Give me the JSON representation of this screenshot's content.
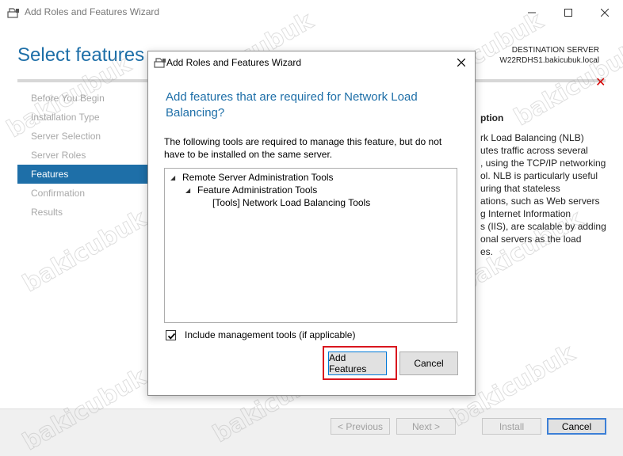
{
  "window": {
    "title": "Add Roles and Features Wizard",
    "page_title": "Select features",
    "destination_label": "DESTINATION SERVER",
    "destination_server": "W22RDHS1.bakicubuk.local"
  },
  "nav": {
    "items": [
      {
        "label": "Before You Begin",
        "active": false
      },
      {
        "label": "Installation Type",
        "active": false
      },
      {
        "label": "Server Selection",
        "active": false
      },
      {
        "label": "Server Roles",
        "active": false
      },
      {
        "label": "Features",
        "active": true
      },
      {
        "label": "Confirmation",
        "active": false
      },
      {
        "label": "Results",
        "active": false
      }
    ]
  },
  "description": {
    "title": "ption",
    "lines": [
      "rk Load Balancing (NLB)",
      "utes traffic across several",
      ", using the TCP/IP networking",
      "ol. NLB is particularly useful",
      "uring that stateless",
      "ations, such as Web servers",
      "g Internet Information",
      "s (IIS), are scalable by adding",
      "onal servers as the load",
      "es."
    ]
  },
  "buttons": {
    "previous": "< Previous",
    "next": "Next >",
    "install": "Install",
    "cancel": "Cancel"
  },
  "dialog": {
    "title": "Add Roles and Features Wizard",
    "heading": "Add features that are required for Network Load Balancing?",
    "text": "The following tools are required to manage this feature, but do not have to be installed on the same server.",
    "tree": [
      {
        "label": "Remote Server Administration Tools",
        "level": 0,
        "expanded": true
      },
      {
        "label": "Feature Administration Tools",
        "level": 1,
        "expanded": true
      },
      {
        "label": "[Tools] Network Load Balancing Tools",
        "level": 2,
        "expanded": false
      }
    ],
    "include_tools_label": "Include management tools (if applicable)",
    "include_tools_checked": true,
    "add_features_label": "Add Features",
    "cancel_label": "Cancel"
  },
  "watermark": "bakicubuk",
  "colors": {
    "accent": "#1e6fa8",
    "highlight_red": "#d9161e",
    "close_x_red": "#d60000"
  }
}
